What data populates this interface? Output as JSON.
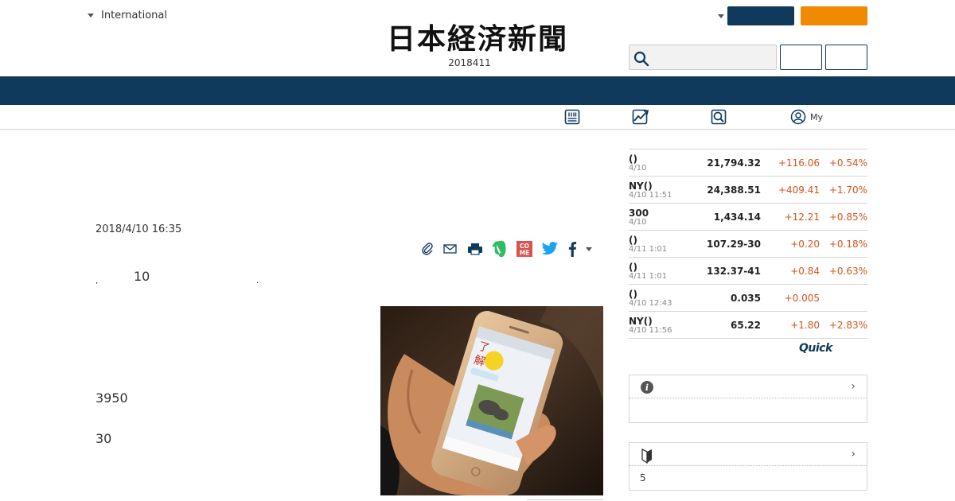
{
  "header": {
    "region_label": "International",
    "logo_text": "日本経済新聞",
    "edition_date": "2018411",
    "search": {
      "placeholder": ""
    }
  },
  "subnav": {
    "items": [
      {
        "icon": "newspaper-icon",
        "label": ""
      },
      {
        "icon": "chart-icon",
        "label": ""
      },
      {
        "icon": "search-report-icon",
        "label": ""
      },
      {
        "icon": "user-icon",
        "label": "My"
      }
    ]
  },
  "article": {
    "timestamp": "2018/4/10 16:35",
    "lead_dot_a": ",",
    "lead_number": "10",
    "lead_dot_b": ".",
    "body_number_1": "3950",
    "body_number_2": "30"
  },
  "share": {
    "icons": [
      "clip-icon",
      "mail-icon",
      "print-icon",
      "evernote-icon",
      "come-icon",
      "twitter-icon",
      "facebook-icon",
      "more-caret-icon"
    ],
    "come_label": "CO\nME"
  },
  "market": {
    "rows": [
      {
        "name": "()",
        "time": "4/10",
        "value": "21,794.32",
        "change": "+116.06",
        "pct": "+0.54%"
      },
      {
        "name": "NY()",
        "time": "4/10 11:51",
        "value": "24,388.51",
        "change": "+409.41",
        "pct": "+1.70%"
      },
      {
        "name": "300",
        "time": "4/10",
        "value": "1,434.14",
        "change": "+12.21",
        "pct": "+0.85%"
      },
      {
        "name": "()",
        "time": "4/11 1:01",
        "value": "107.29-30",
        "change": "+0.20",
        "pct": "+0.18%"
      },
      {
        "name": "()",
        "time": "4/11 1:01",
        "value": "132.37-41",
        "change": "+0.84",
        "pct": "+0.63%"
      },
      {
        "name": "()",
        "time": "4/10 12:43",
        "value": "0.035",
        "change": "+0.005",
        "pct": ""
      },
      {
        "name": "NY()",
        "time": "4/10 11:56",
        "value": "65.22",
        "change": "+1.80",
        "pct": "+2.83%"
      }
    ],
    "provider_logo": "Quick",
    "up_color": "#d4541c"
  },
  "side_boxes": [
    {
      "icon": "info-icon",
      "chevron": "›",
      "body": ""
    },
    {
      "icon": "beginner-mark-icon",
      "chevron": "›",
      "body": "5"
    }
  ],
  "colors": {
    "navy": "#0f3a5c",
    "orange": "#f08a00"
  }
}
